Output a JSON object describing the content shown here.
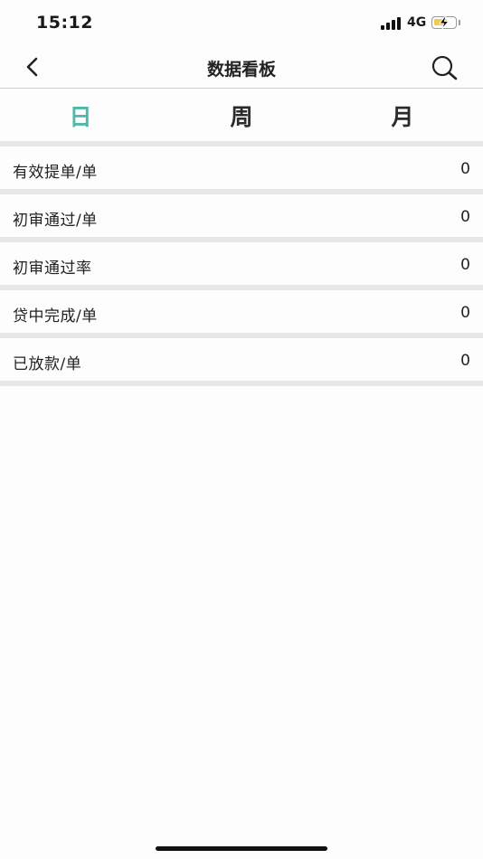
{
  "status_bar": {
    "time": "15:12",
    "network": "4G",
    "battery_level": 0.65,
    "charging": true,
    "signal_bars": 4
  },
  "nav": {
    "title": "数据看板",
    "back_icon": "chevron-left-icon",
    "search_icon": "search-icon"
  },
  "tabs": {
    "items": [
      {
        "label": "日",
        "active": true
      },
      {
        "label": "周",
        "active": false
      },
      {
        "label": "月",
        "active": false
      }
    ],
    "active_color": "#4fb8a8"
  },
  "metrics": [
    {
      "label": "有效提单/单",
      "value": "0"
    },
    {
      "label": "初审通过/单",
      "value": "0"
    },
    {
      "label": "初审通过率",
      "value": "0"
    },
    {
      "label": "贷中完成/单",
      "value": "0"
    },
    {
      "label": "已放款/单",
      "value": "0"
    }
  ]
}
